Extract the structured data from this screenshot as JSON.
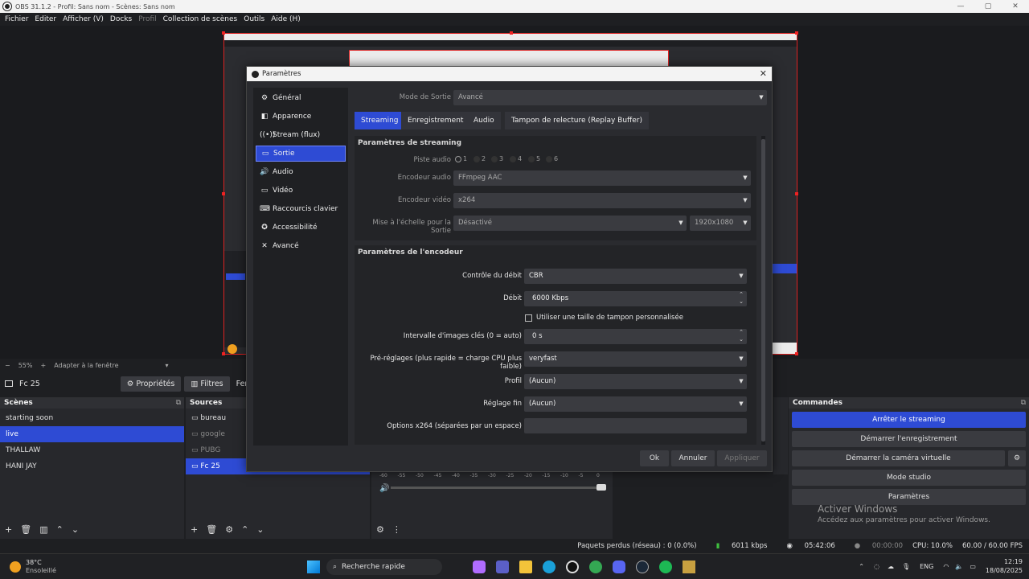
{
  "window": {
    "title": "OBS 31.1.2 - Profil: Sans nom - Scènes: Sans nom",
    "controls": [
      "—",
      "▢",
      "✕"
    ]
  },
  "menu": [
    "Fichier",
    "Editer",
    "Afficher (V)",
    "Docks",
    "Profil",
    "Collection de scènes",
    "Outils",
    "Aide (H)"
  ],
  "zoombar": {
    "minus": "−",
    "zoom": "55%",
    "plus": "+",
    "fit": "Adapter à la fenêtre"
  },
  "source_toolbar": {
    "source_name": "Fc 25",
    "properties": "Propriétés",
    "filters": "Filtres",
    "window": "Fenê"
  },
  "scenes": {
    "title": "Scènes",
    "items": [
      "starting soon",
      "live",
      "THALLAW",
      "HANI JAY"
    ],
    "selected": 1
  },
  "sources": {
    "title": "Sources",
    "items": [
      "bureau",
      "google",
      "PUBG",
      "Fc 25"
    ],
    "selected": 3
  },
  "commands": {
    "title": "Commandes",
    "buttons": [
      "Arrêter le streaming",
      "Démarrer l'enregistrement",
      "Démarrer la caméra virtuelle",
      "Mode studio",
      "Paramètres"
    ]
  },
  "watermark": {
    "line1": "Activer Windows",
    "line2": "Accédez aux paramètres pour activer Windows."
  },
  "mixer_ticks": [
    "-60",
    "-55",
    "-50",
    "-45",
    "-40",
    "-35",
    "-30",
    "-25",
    "-20",
    "-15",
    "-10",
    "-5",
    "0"
  ],
  "status": {
    "dropped": "Paquets perdus (réseau) : 0 (0.0%)",
    "bitrate": "6011 kbps",
    "stream_time": "05:42:06",
    "rec_time": "00:00:00",
    "cpu": "CPU: 10.0%",
    "fps": "60.00 / 60.00 FPS"
  },
  "taskbar": {
    "weather_temp": "38°C",
    "weather_desc": "Ensoleillé",
    "search": "Recherche rapide",
    "lang": "ENG",
    "time": "12:19",
    "date": "18/08/2025"
  },
  "dialog": {
    "title": "Paramètres",
    "nav": [
      "Général",
      "Apparence",
      "Stream (flux)",
      "Sortie",
      "Audio",
      "Vidéo",
      "Raccourcis clavier",
      "Accessibilité",
      "Avancé"
    ],
    "nav_selected": 3,
    "output_mode_label": "Mode de Sortie",
    "output_mode": "Avancé",
    "tabs": [
      "Streaming",
      "Enregistrement",
      "Audio",
      "Tampon de relecture (Replay Buffer)"
    ],
    "streaming_group": {
      "title": "Paramètres de streaming",
      "audio_track_label": "Piste audio",
      "tracks": [
        "1",
        "2",
        "3",
        "4",
        "5",
        "6"
      ],
      "audio_encoder_label": "Encodeur audio",
      "audio_encoder": "FFmpeg AAC",
      "video_encoder_label": "Encodeur vidéo",
      "video_encoder": "x264",
      "rescale_label": "Mise à l'échelle pour la Sortie",
      "rescale": "Désactivé",
      "rescale_res": "1920x1080"
    },
    "encoder_group": {
      "title": "Paramètres de l'encodeur",
      "rate_control_label": "Contrôle du débit",
      "rate_control": "CBR",
      "bitrate_label": "Débit",
      "bitrate": "6000 Kbps",
      "custom_buffer": "Utiliser une taille de tampon personnalisée",
      "keyframe_label": "Intervalle d'images clés (0 = auto)",
      "keyframe": "0 s",
      "preset_label": "Pré-réglages (plus rapide = charge CPU plus faible)",
      "preset": "veryfast",
      "profile_label": "Profil",
      "profile": "(Aucun)",
      "tune_label": "Réglage fin",
      "tune": "(Aucun)",
      "options_label": "Options x264 (séparées par un espace)",
      "options": ""
    },
    "buttons": {
      "ok": "Ok",
      "cancel": "Annuler",
      "apply": "Appliquer"
    }
  },
  "icons": {
    "gear": "gear-icon",
    "close": "close-icon",
    "chevron": "chevron-down-icon"
  }
}
